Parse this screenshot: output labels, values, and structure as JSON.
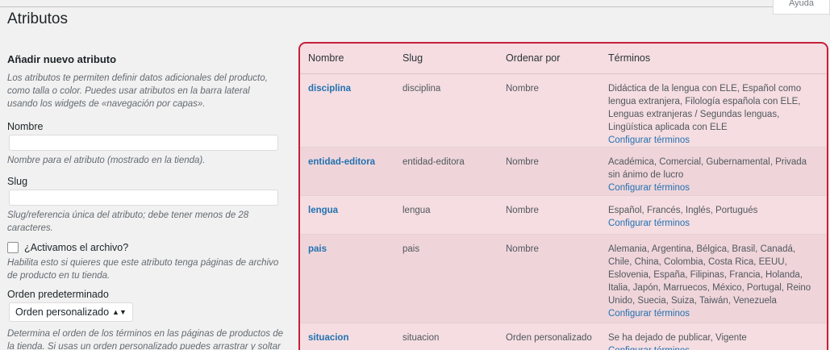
{
  "help_tab": "Ayuda",
  "page_title": "Atributos",
  "form": {
    "title": "Añadir nuevo atributo",
    "intro": "Los atributos te permiten definir datos adicionales del producto, como talla o color. Puedes usar atributos en la barra lateral usando los widgets de «navegación por capas».",
    "name_label": "Nombre",
    "name_value": "",
    "name_hint": "Nombre para el atributo (mostrado en la tienda).",
    "slug_label": "Slug",
    "slug_value": "",
    "slug_hint": "Slug/referencia única del atributo; debe tener menos de 28 caracteres.",
    "archive_label": "¿Activamos el archivo?",
    "archive_checked": false,
    "archive_hint": "Habilita esto si quieres que este atributo tenga páginas de archivo de producto en tu tienda.",
    "order_label": "Orden predeterminado",
    "order_selected": "Orden personalizado",
    "order_hint": "Determina el orden de los términos en las páginas de productos de la tienda. Si usas un orden personalizado puedes arrastrar y soltar los"
  },
  "table": {
    "headers": [
      "Nombre",
      "Slug",
      "Ordenar por",
      "Términos"
    ],
    "configure_label": "Configurar términos",
    "rows": [
      {
        "name": "disciplina",
        "slug": "disciplina",
        "order": "Nombre",
        "terms": "Didáctica de la lengua con ELE, Español como lengua extranjera, Filología española con ELE, Lenguas extranjeras / Segundas lenguas, Lingüística aplicada con ELE"
      },
      {
        "name": "entidad-editora",
        "slug": "entidad-editora",
        "order": "Nombre",
        "terms": "Académica, Comercial, Gubernamental, Privada sin ánimo de lucro"
      },
      {
        "name": "lengua",
        "slug": "lengua",
        "order": "Nombre",
        "terms": "Español, Francés, Inglés, Portugués"
      },
      {
        "name": "pais",
        "slug": "pais",
        "order": "Nombre",
        "terms": "Alemania, Argentina, Bélgica, Brasil, Canadá, Chile, China, Colombia, Costa Rica, EEUU, Eslovenia, España, Filipinas, Francia, Holanda, Italia, Japón, Marruecos, México, Portugal, Reino Unido, Suecia, Suiza, Taiwán, Venezuela"
      },
      {
        "name": "situacion",
        "slug": "situacion",
        "order": "Orden personalizado",
        "terms": "Se ha dejado de publicar, Vigente"
      }
    ]
  },
  "colors": {
    "link": "#2271b1",
    "highlight_border": "#c71f3a",
    "highlight_fill": "#f5dde1"
  }
}
